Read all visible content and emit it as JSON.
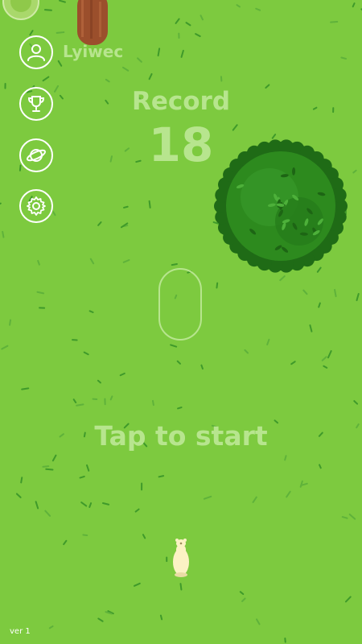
{
  "player": {
    "username": "Lyiwec"
  },
  "record": {
    "label": "Record",
    "value": "18"
  },
  "prompt": {
    "tap_to_start": "Tap to start"
  },
  "footer": {
    "version": "ver 1"
  },
  "menu": {
    "icons": [
      "profile-icon",
      "trophy-icon",
      "planet-icon",
      "settings-gear-icon"
    ]
  },
  "colors": {
    "grass": "#7dca3f",
    "text_faded": "#b7e58e",
    "bush_dark": "#1f6b16",
    "bush_mid": "#2d8a1e",
    "log_brown": "#9b4f2c",
    "player": "#fbf2c4"
  }
}
